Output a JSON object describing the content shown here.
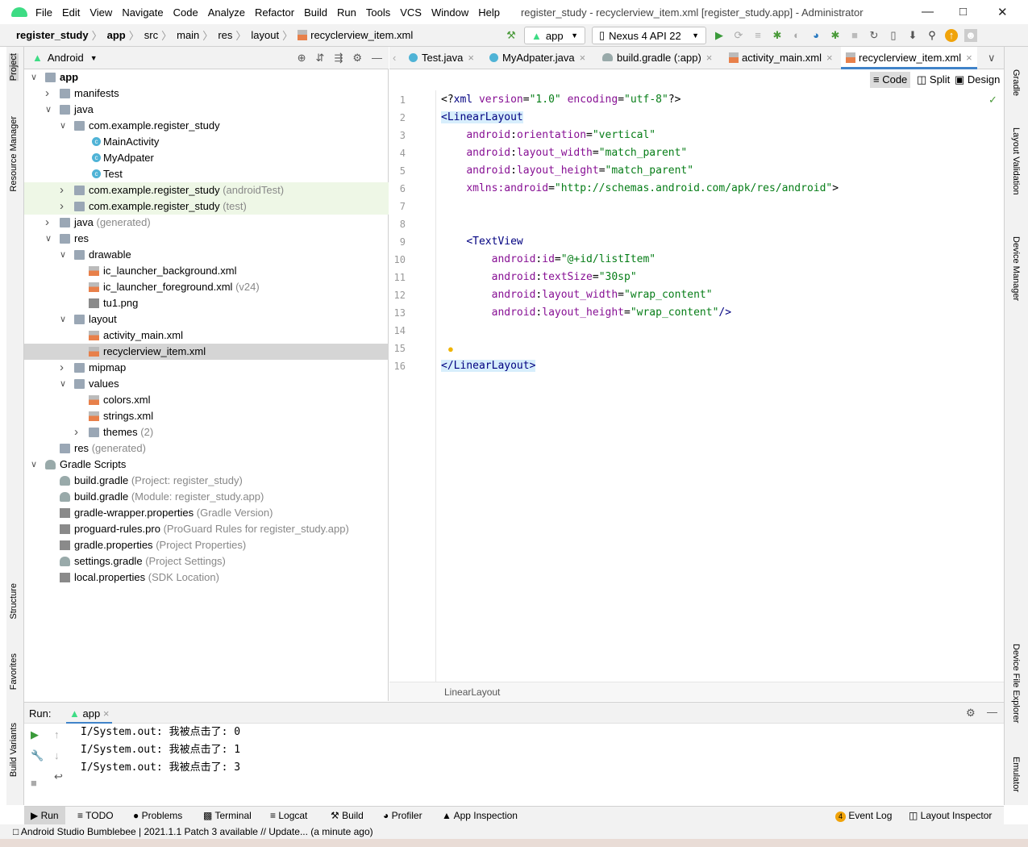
{
  "menu": {
    "items": [
      "File",
      "Edit",
      "View",
      "Navigate",
      "Code",
      "Analyze",
      "Refactor",
      "Build",
      "Run",
      "Tools",
      "VCS",
      "Window",
      "Help"
    ],
    "window_title": "register_study - recyclerview_item.xml [register_study.app] - Administrator"
  },
  "breadcrumb": [
    "register_study",
    "app",
    "src",
    "main",
    "res",
    "layout",
    "recyclerview_item.xml"
  ],
  "toolbar": {
    "config": "app",
    "device": "Nexus 4 API 22"
  },
  "project": {
    "view": "Android",
    "tree": [
      {
        "d": 0,
        "a": "v",
        "i": "fold",
        "t": "app",
        "b": true
      },
      {
        "d": 1,
        "a": ">",
        "i": "fold",
        "t": "manifests"
      },
      {
        "d": 1,
        "a": "v",
        "i": "fold",
        "t": "java"
      },
      {
        "d": 2,
        "a": "v",
        "i": "fold",
        "t": "com.example.register_study"
      },
      {
        "d": 3,
        "a": "",
        "i": "cls",
        "t": "MainActivity"
      },
      {
        "d": 3,
        "a": "",
        "i": "cls",
        "t": "MyAdpater"
      },
      {
        "d": 3,
        "a": "",
        "i": "cls",
        "t": "Test"
      },
      {
        "d": 2,
        "a": ">",
        "i": "fold",
        "t": "com.example.register_study",
        "h": "(androidTest)",
        "test": true
      },
      {
        "d": 2,
        "a": ">",
        "i": "fold",
        "t": "com.example.register_study",
        "h": "(test)",
        "test": true
      },
      {
        "d": 1,
        "a": ">",
        "i": "fold",
        "t": "java",
        "h": "(generated)"
      },
      {
        "d": 1,
        "a": "v",
        "i": "fold",
        "t": "res"
      },
      {
        "d": 2,
        "a": "v",
        "i": "fold",
        "t": "drawable"
      },
      {
        "d": 3,
        "a": "",
        "i": "xml",
        "t": "ic_launcher_background.xml"
      },
      {
        "d": 3,
        "a": "",
        "i": "xml",
        "t": "ic_launcher_foreground.xml",
        "h": "(v24)"
      },
      {
        "d": 3,
        "a": "",
        "i": "prop",
        "t": "tu1.png"
      },
      {
        "d": 2,
        "a": "v",
        "i": "fold",
        "t": "layout"
      },
      {
        "d": 3,
        "a": "",
        "i": "xml",
        "t": "activity_main.xml"
      },
      {
        "d": 3,
        "a": "",
        "i": "xml",
        "t": "recyclerview_item.xml",
        "sel": true
      },
      {
        "d": 2,
        "a": ">",
        "i": "fold",
        "t": "mipmap"
      },
      {
        "d": 2,
        "a": "v",
        "i": "fold",
        "t": "values"
      },
      {
        "d": 3,
        "a": "",
        "i": "xml",
        "t": "colors.xml"
      },
      {
        "d": 3,
        "a": "",
        "i": "xml",
        "t": "strings.xml"
      },
      {
        "d": 3,
        "a": ">",
        "i": "fold",
        "t": "themes",
        "h": "(2)"
      },
      {
        "d": 1,
        "a": "",
        "i": "fold",
        "t": "res",
        "h": "(generated)"
      },
      {
        "d": 0,
        "a": "v",
        "i": "grd",
        "t": "Gradle Scripts"
      },
      {
        "d": 1,
        "a": "",
        "i": "grd",
        "t": "build.gradle",
        "h": "(Project: register_study)"
      },
      {
        "d": 1,
        "a": "",
        "i": "grd",
        "t": "build.gradle",
        "h": "(Module: register_study.app)"
      },
      {
        "d": 1,
        "a": "",
        "i": "prop",
        "t": "gradle-wrapper.properties",
        "h": "(Gradle Version)"
      },
      {
        "d": 1,
        "a": "",
        "i": "prop",
        "t": "proguard-rules.pro",
        "h": "(ProGuard Rules for register_study.app)"
      },
      {
        "d": 1,
        "a": "",
        "i": "prop",
        "t": "gradle.properties",
        "h": "(Project Properties)"
      },
      {
        "d": 1,
        "a": "",
        "i": "grd",
        "t": "settings.gradle",
        "h": "(Project Settings)"
      },
      {
        "d": 1,
        "a": "",
        "i": "prop",
        "t": "local.properties",
        "h": "(SDK Location)"
      }
    ]
  },
  "tabs": [
    {
      "t": "Test.java",
      "i": "cls"
    },
    {
      "t": "MyAdpater.java",
      "i": "cls"
    },
    {
      "t": "build.gradle (:app)",
      "i": "grd"
    },
    {
      "t": "activity_main.xml",
      "i": "xml"
    },
    {
      "t": "recyclerview_item.xml",
      "i": "xml",
      "active": true
    }
  ],
  "editor_modes": [
    "Code",
    "Split",
    "Design"
  ],
  "code": [
    [
      [
        "p",
        "<?"
      ],
      [
        "tag",
        "xml "
      ],
      [
        "attr",
        "version"
      ],
      [
        "p",
        "="
      ],
      [
        "val",
        "\"1.0\" "
      ],
      [
        "attr",
        "encoding"
      ],
      [
        "p",
        "="
      ],
      [
        "val",
        "\"utf-8\""
      ],
      [
        "p",
        "?>"
      ]
    ],
    [
      [
        "hl",
        "<LinearLayout"
      ]
    ],
    [
      [
        "p",
        "    "
      ],
      [
        "ns",
        "android"
      ],
      [
        "p",
        ":"
      ],
      [
        "attr",
        "orientation"
      ],
      [
        "p",
        "="
      ],
      [
        "val",
        "\"vertical\""
      ]
    ],
    [
      [
        "p",
        "    "
      ],
      [
        "ns",
        "android"
      ],
      [
        "p",
        ":"
      ],
      [
        "attr",
        "layout_width"
      ],
      [
        "p",
        "="
      ],
      [
        "val",
        "\"match_parent\""
      ]
    ],
    [
      [
        "p",
        "    "
      ],
      [
        "ns",
        "android"
      ],
      [
        "p",
        ":"
      ],
      [
        "attr",
        "layout_height"
      ],
      [
        "p",
        "="
      ],
      [
        "val",
        "\"match_parent\""
      ]
    ],
    [
      [
        "p",
        "    "
      ],
      [
        "ns",
        "xmlns:android"
      ],
      [
        "p",
        "="
      ],
      [
        "val",
        "\"http://schemas.android.com/apk/res/android\""
      ],
      [
        "p",
        ">"
      ]
    ],
    [],
    [],
    [
      [
        "p",
        "    "
      ],
      [
        "tag",
        "<TextView"
      ]
    ],
    [
      [
        "p",
        "        "
      ],
      [
        "ns",
        "android"
      ],
      [
        "p",
        ":"
      ],
      [
        "attr",
        "id"
      ],
      [
        "p",
        "="
      ],
      [
        "val",
        "\"@+id/listItem\""
      ]
    ],
    [
      [
        "p",
        "        "
      ],
      [
        "ns",
        "android"
      ],
      [
        "p",
        ":"
      ],
      [
        "attr",
        "textSize"
      ],
      [
        "p",
        "="
      ],
      [
        "val",
        "\"30sp\""
      ]
    ],
    [
      [
        "p",
        "        "
      ],
      [
        "ns",
        "android"
      ],
      [
        "p",
        ":"
      ],
      [
        "attr",
        "layout_width"
      ],
      [
        "p",
        "="
      ],
      [
        "val",
        "\"wrap_content\""
      ]
    ],
    [
      [
        "p",
        "        "
      ],
      [
        "ns",
        "android"
      ],
      [
        "p",
        ":"
      ],
      [
        "attr",
        "layout_height"
      ],
      [
        "p",
        "="
      ],
      [
        "val",
        "\"wrap_content\""
      ],
      [
        "tag",
        "/>"
      ]
    ],
    [],
    [],
    [
      [
        "hl",
        "</LinearLayout>"
      ]
    ]
  ],
  "editor_status": "LinearLayout",
  "run": {
    "label": "Run:",
    "tab": "app",
    "output": [
      "I/System.out: 我被点击了: 0",
      "I/System.out: 我被点击了: 1",
      "I/System.out: 我被点击了: 3"
    ]
  },
  "bottom_tools": [
    "Run",
    "TODO",
    "Problems",
    "Terminal",
    "Logcat",
    "Build",
    "Profiler",
    "App Inspection"
  ],
  "bottom_right": {
    "event_log": "Event Log",
    "event_count": "4",
    "layout_inspector": "Layout Inspector"
  },
  "left_stripe": [
    "Project",
    "Resource Manager",
    "Structure",
    "Favorites",
    "Build Variants"
  ],
  "right_stripe": [
    "Gradle",
    "Layout Validation",
    "Device Manager",
    "Device File Explorer",
    "Emulator"
  ],
  "status": "Android Studio Bumblebee | 2021.1.1 Patch 3 available // Update... (a minute ago)",
  "colors": {
    "accent": "#4083c9",
    "android_green": "#3ddc84",
    "selection": "#d5d5d5"
  }
}
